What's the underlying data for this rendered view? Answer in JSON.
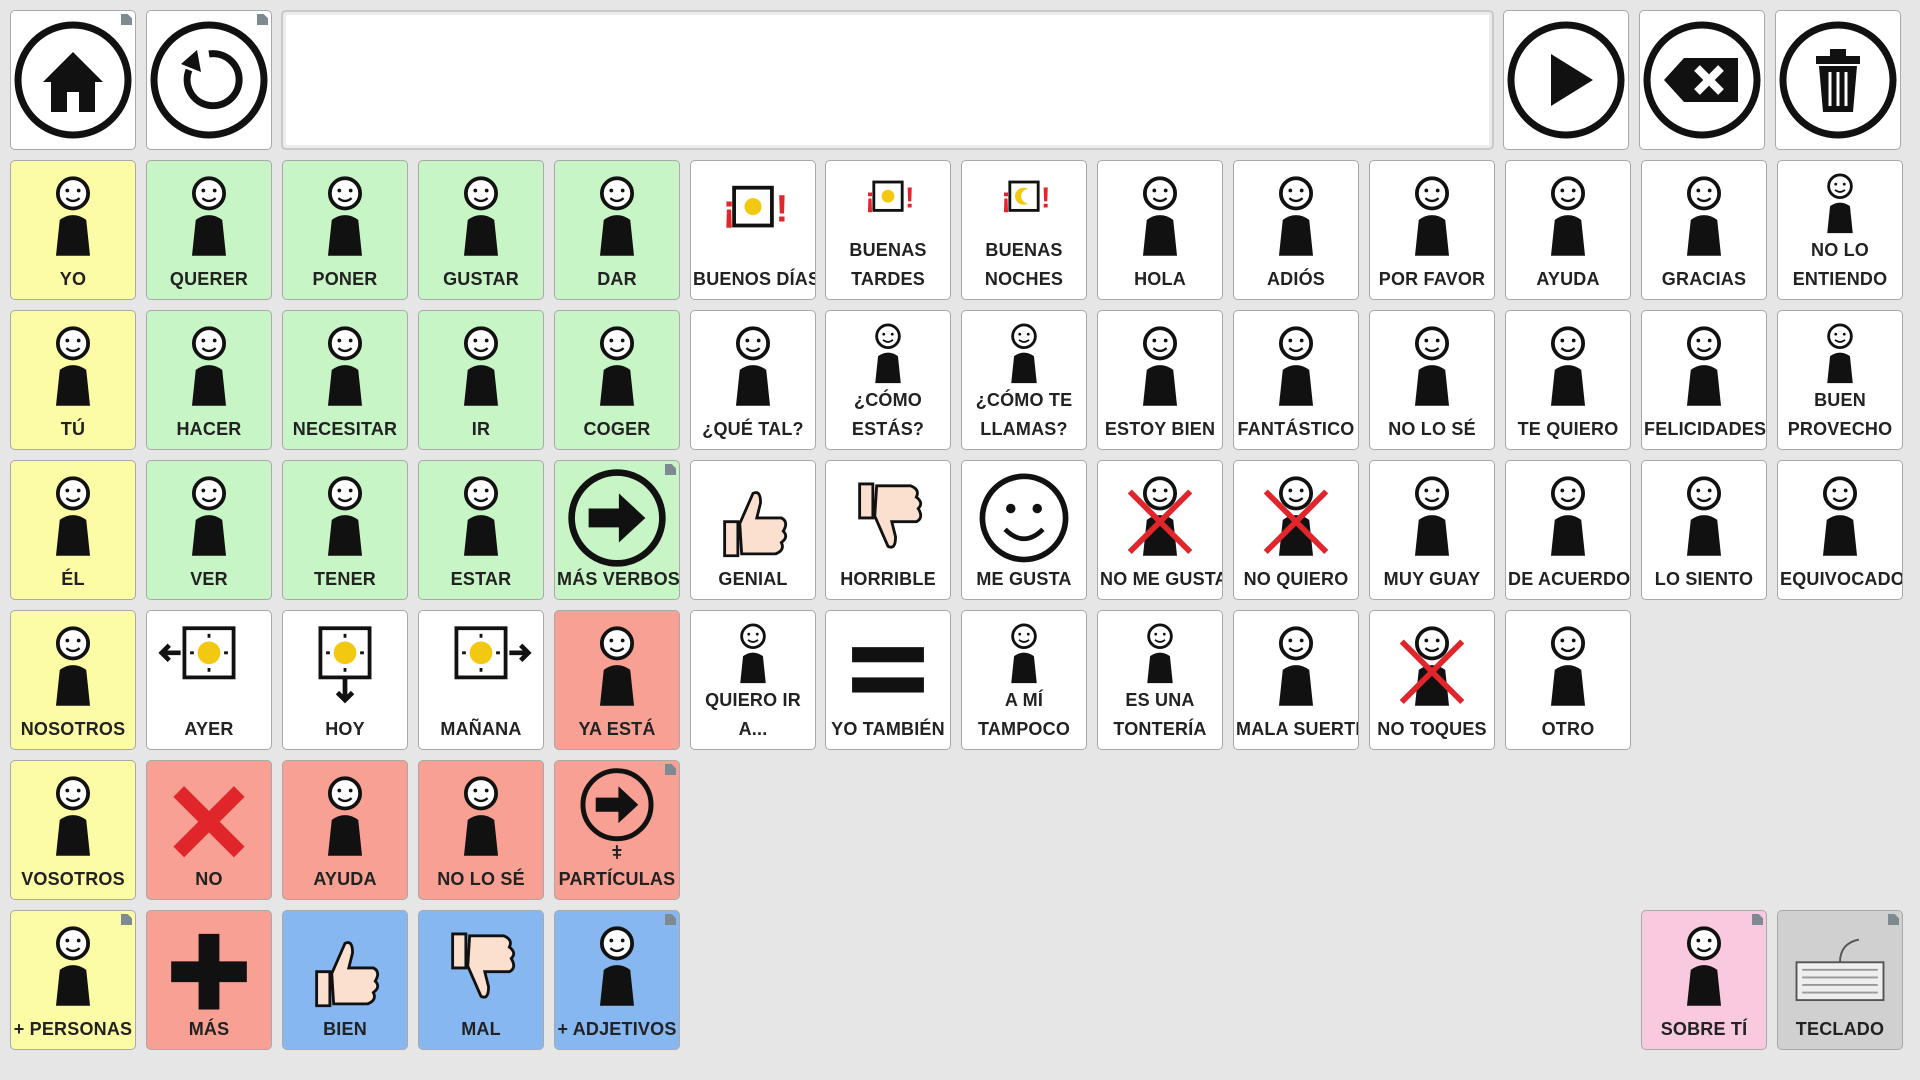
{
  "colors": {
    "background": "#e6e6e6",
    "pronoun_yellow": "#fcfca6",
    "verb_green": "#c8f5c6",
    "social_white": "#ffffff",
    "negative_red": "#f7a093",
    "adjective_blue": "#87b7f0",
    "pink": "#f9c9df",
    "gray": "#d0d0d0"
  },
  "toolbar": {
    "home": {
      "icon": "home-icon"
    },
    "undo": {
      "icon": "undo-icon"
    },
    "message_bar": {
      "text": ""
    },
    "speak": {
      "icon": "play-icon"
    },
    "backspace": {
      "icon": "backspace-icon"
    },
    "clear": {
      "icon": "trash-icon"
    }
  },
  "rows": [
    [
      {
        "label": "YO",
        "color": "pronoun_yellow",
        "icon": "i-me-icon"
      },
      {
        "label": "QUERER",
        "color": "verb_green",
        "icon": "want-icon"
      },
      {
        "label": "PONER",
        "color": "verb_green",
        "icon": "put-icon"
      },
      {
        "label": "GUSTAR",
        "color": "verb_green",
        "icon": "like-icon"
      },
      {
        "label": "DAR",
        "color": "verb_green",
        "icon": "give-icon"
      },
      {
        "label": "BUENOS DÍAS",
        "color": "social_white",
        "icon": "good-morning-icon"
      },
      {
        "label": "BUENAS TARDES",
        "color": "social_white",
        "icon": "good-afternoon-icon"
      },
      {
        "label": "BUENAS NOCHES",
        "color": "social_white",
        "icon": "good-night-icon"
      },
      {
        "label": "HOLA",
        "color": "social_white",
        "icon": "hello-icon"
      },
      {
        "label": "ADIÓS",
        "color": "social_white",
        "icon": "goodbye-icon"
      },
      {
        "label": "POR FAVOR",
        "color": "social_white",
        "icon": "please-icon"
      },
      {
        "label": "AYUDA",
        "color": "social_white",
        "icon": "help-icon"
      },
      {
        "label": "GRACIAS",
        "color": "social_white",
        "icon": "thanks-icon"
      },
      {
        "label": "NO LO ENTIENDO",
        "color": "social_white",
        "icon": "dont-understand-icon"
      }
    ],
    [
      {
        "label": "TÚ",
        "color": "pronoun_yellow",
        "icon": "you-icon"
      },
      {
        "label": "HACER",
        "color": "verb_green",
        "icon": "make-icon"
      },
      {
        "label": "NECESITAR",
        "color": "verb_green",
        "icon": "need-icon"
      },
      {
        "label": "IR",
        "color": "verb_green",
        "icon": "go-icon"
      },
      {
        "label": "COGER",
        "color": "verb_green",
        "icon": "take-icon"
      },
      {
        "label": "¿QUÉ TAL?",
        "color": "social_white",
        "icon": "how-are-things-icon"
      },
      {
        "label": "¿CÓMO ESTÁS?",
        "color": "social_white",
        "icon": "how-are-you-icon"
      },
      {
        "label": "¿CÓMO TE LLAMAS?",
        "color": "social_white",
        "icon": "whats-your-name-icon"
      },
      {
        "label": "ESTOY BIEN",
        "color": "social_white",
        "icon": "im-fine-icon"
      },
      {
        "label": "FANTÁSTICO",
        "color": "social_white",
        "icon": "fantastic-icon"
      },
      {
        "label": "NO LO SÉ",
        "color": "social_white",
        "icon": "dont-know-icon"
      },
      {
        "label": "TE QUIERO",
        "color": "social_white",
        "icon": "love-you-icon"
      },
      {
        "label": "FELICIDADES",
        "color": "social_white",
        "icon": "congrats-icon"
      },
      {
        "label": "BUEN PROVECHO",
        "color": "social_white",
        "icon": "enjoy-meal-icon"
      }
    ],
    [
      {
        "label": "ÉL",
        "color": "pronoun_yellow",
        "icon": "he-icon"
      },
      {
        "label": "VER",
        "color": "verb_green",
        "icon": "see-icon"
      },
      {
        "label": "TENER",
        "color": "verb_green",
        "icon": "have-icon"
      },
      {
        "label": "ESTAR",
        "color": "verb_green",
        "icon": "be-icon"
      },
      {
        "label": "MÁS VERBOS",
        "color": "verb_green",
        "icon": "more-verbs-arrow-icon",
        "folder": true
      },
      {
        "label": "GENIAL",
        "color": "social_white",
        "icon": "thumbs-up-icon"
      },
      {
        "label": "HORRIBLE",
        "color": "social_white",
        "icon": "thumbs-down-icon"
      },
      {
        "label": "ME GUSTA",
        "color": "social_white",
        "icon": "smile-icon"
      },
      {
        "label": "NO ME GUSTA",
        "color": "social_white",
        "icon": "dislike-icon"
      },
      {
        "label": "NO QUIERO",
        "color": "social_white",
        "icon": "dont-want-icon"
      },
      {
        "label": "MUY GUAY",
        "color": "social_white",
        "icon": "very-cool-icon"
      },
      {
        "label": "DE ACUERDO",
        "color": "social_white",
        "icon": "ok-hand-icon"
      },
      {
        "label": "LO SIENTO",
        "color": "social_white",
        "icon": "sorry-icon"
      },
      {
        "label": "EQUIVOCADO",
        "color": "social_white",
        "icon": "wrong-icon"
      }
    ],
    [
      {
        "label": "NOSOTROS",
        "color": "pronoun_yellow",
        "icon": "we-icon"
      },
      {
        "label": "AYER",
        "color": "social_white",
        "icon": "yesterday-icon"
      },
      {
        "label": "HOY",
        "color": "social_white",
        "icon": "today-icon"
      },
      {
        "label": "MAÑANA",
        "color": "social_white",
        "icon": "tomorrow-icon"
      },
      {
        "label": "YA ESTÁ",
        "color": "negative_red",
        "icon": "done-icon"
      },
      {
        "label": "QUIERO IR A...",
        "color": "social_white",
        "icon": "want-to-go-icon"
      },
      {
        "label": "YO TAMBIÉN",
        "color": "social_white",
        "icon": "equals-icon"
      },
      {
        "label": "A MÍ TAMPOCO",
        "color": "social_white",
        "icon": "me-neither-icon"
      },
      {
        "label": "ES UNA TONTERÍA",
        "color": "social_white",
        "icon": "nonsense-icon"
      },
      {
        "label": "MALA SUERTE",
        "color": "social_white",
        "icon": "bad-luck-icon"
      },
      {
        "label": "NO TOQUES",
        "color": "social_white",
        "icon": "dont-touch-icon"
      },
      {
        "label": "OTRO",
        "color": "social_white",
        "icon": "other-icon"
      }
    ],
    [
      {
        "label": "VOSOTROS",
        "color": "pronoun_yellow",
        "icon": "you-plural-icon"
      },
      {
        "label": "NO",
        "color": "negative_red",
        "icon": "x-icon"
      },
      {
        "label": "AYUDA",
        "color": "negative_red",
        "icon": "help-hands-icon"
      },
      {
        "label": "NO LO SÉ",
        "color": "negative_red",
        "icon": "dont-know-icon"
      },
      {
        "label": "+ PARTÍCULAS",
        "color": "negative_red",
        "icon": "particles-arrow-icon",
        "folder": true,
        "sub": "+"
      }
    ],
    [
      {
        "label": "+ PERSONAS",
        "color": "pronoun_yellow",
        "icon": "people-icon",
        "folder": true
      },
      {
        "label": "MÁS",
        "color": "negative_red",
        "icon": "plus-icon"
      },
      {
        "label": "BIEN",
        "color": "adjective_blue",
        "icon": "thumbs-up-icon"
      },
      {
        "label": "MAL",
        "color": "adjective_blue",
        "icon": "thumbs-down-icon"
      },
      {
        "label": "+ ADJETIVOS",
        "color": "adjective_blue",
        "icon": "adjectives-icon",
        "folder": true
      }
    ]
  ],
  "extras": [
    {
      "label": "SOBRE TÍ",
      "color": "pink",
      "icon": "about-you-icon",
      "folder": true
    },
    {
      "label": "TECLADO",
      "color": "gray",
      "icon": "keyboard-icon",
      "folder": true
    }
  ]
}
